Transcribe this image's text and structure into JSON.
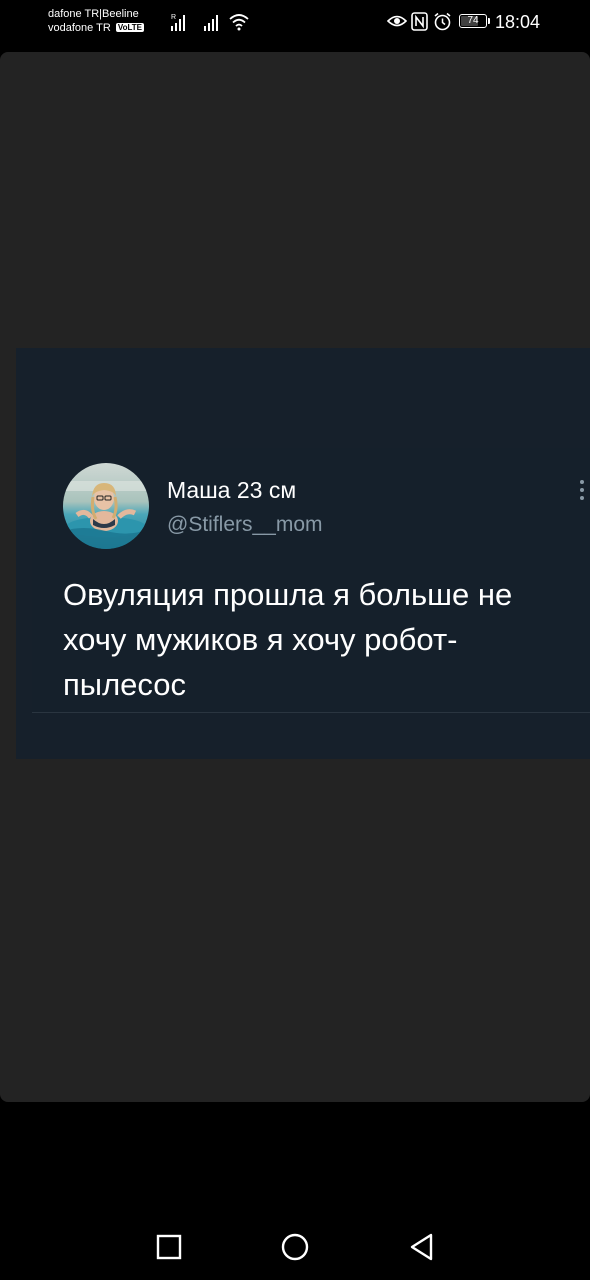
{
  "status_bar": {
    "carrier_line_1": "dafone TR|Beeline",
    "carrier_line_2": "vodafone TR",
    "volte_badge": "VoLTE",
    "signal_1_roaming_mark": "R",
    "battery_percent": "74",
    "battery_level": 0.74,
    "time": "18:04",
    "icons": [
      "signal-icon",
      "signal-icon",
      "wifi-icon",
      "eye-comfort-icon",
      "nfc-icon",
      "alarm-icon",
      "battery-icon"
    ]
  },
  "tweet": {
    "author_name": "Маша 23 см",
    "author_handle": "@Stiflers__mom",
    "text": "Овуляция прошла я больше не хочу мужиков я хочу робот-пылесос"
  },
  "nav_bar": {
    "icons": [
      "recents-icon",
      "home-icon",
      "back-icon"
    ]
  },
  "colors": {
    "page_background": "#000000",
    "viewer_background": "#232323",
    "tweet_background": "#15202b",
    "handle_text": "#8899a6"
  }
}
